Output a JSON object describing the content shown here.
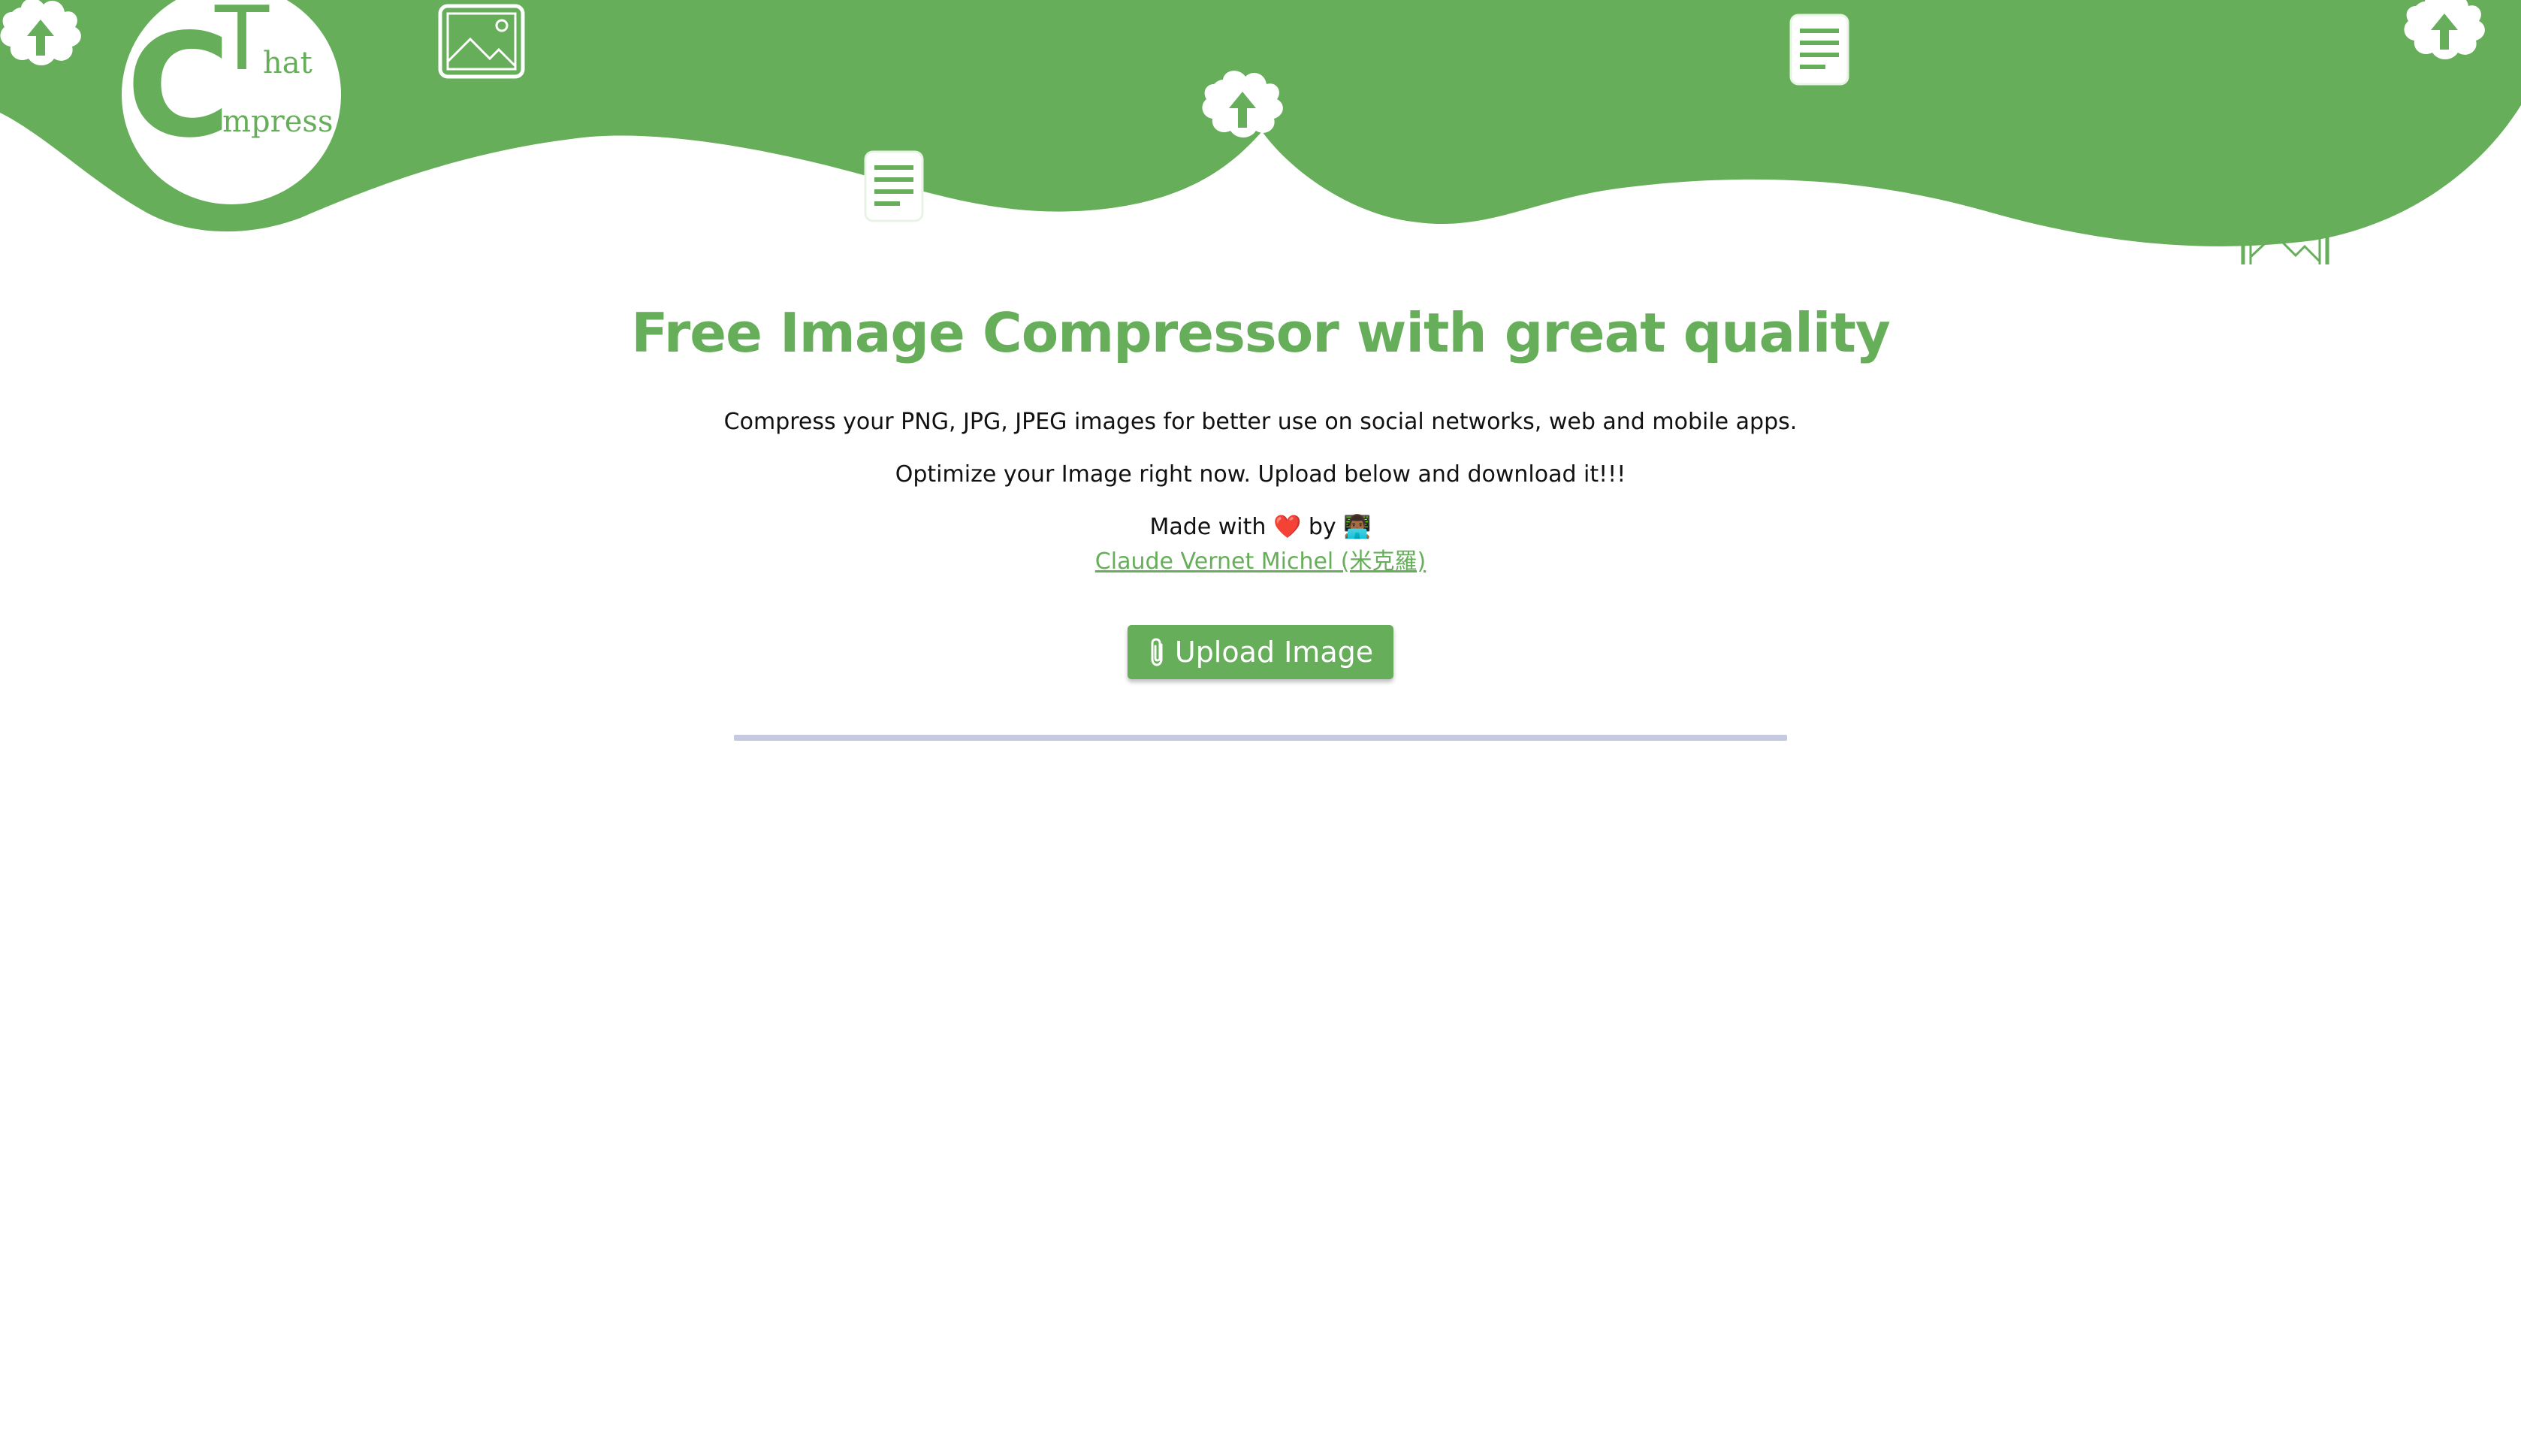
{
  "brand": {
    "logo_letter_t": "T",
    "logo_letter_c": "C",
    "logo_word_hat": "hat",
    "logo_word_ompress": "ompress",
    "accent_color": "#66ae59"
  },
  "header": {
    "decorative_icons": [
      "upload-icon",
      "image-icon",
      "document-icon",
      "upload-icon",
      "document-icon",
      "upload-icon",
      "image-icon"
    ]
  },
  "main": {
    "title": "Free Image Compressor with great quality",
    "subtitle_1": "Compress your PNG, JPG, JPEG images for better use on social networks, web and mobile apps.",
    "subtitle_2": "Optimize your Image right now. Upload below and download it!!!",
    "made_with_prefix": "Made with",
    "heart": "❤️",
    "made_with_by": "by",
    "author_emoji": "👨🏾‍💻",
    "author_link": "Claude Vernet Michel (米克羅)",
    "upload_button_label": "Upload Image",
    "upload_button_icon": "paperclip-icon"
  }
}
